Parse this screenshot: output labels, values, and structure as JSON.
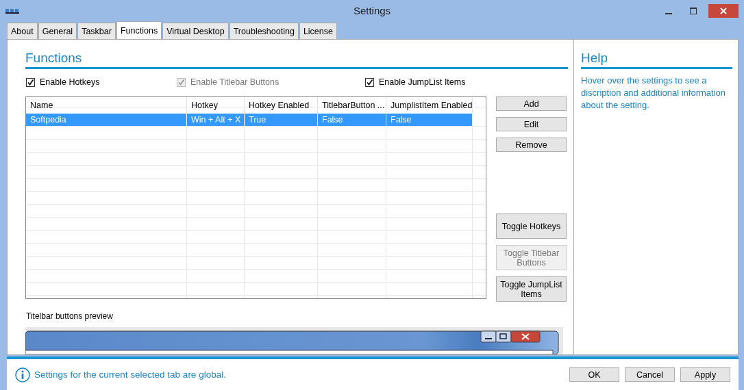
{
  "window": {
    "title": "Settings"
  },
  "tabs": [
    {
      "label": "About",
      "selected": false
    },
    {
      "label": "General",
      "selected": false
    },
    {
      "label": "Taskbar",
      "selected": false
    },
    {
      "label": "Functions",
      "selected": true
    },
    {
      "label": "Virtual Desktop",
      "selected": false
    },
    {
      "label": "Troubleshooting",
      "selected": false
    },
    {
      "label": "License",
      "selected": false
    }
  ],
  "section": {
    "title": "Functions"
  },
  "checkboxes": [
    {
      "label": "Enable Hotkeys",
      "checked": true,
      "disabled": false
    },
    {
      "label": "Enable Titlebar Buttons",
      "checked": true,
      "disabled": true
    },
    {
      "label": "Enable JumpList Items",
      "checked": true,
      "disabled": false
    }
  ],
  "table": {
    "columns": [
      "Name",
      "Hotkey",
      "Hotkey Enabled",
      "TitlebarButton ...",
      "JumplistItem Enabled"
    ],
    "rows": [
      {
        "cells": [
          "Softpedia",
          "Win + Alt + X",
          "True",
          "False",
          "False"
        ],
        "selected": true
      }
    ]
  },
  "row_buttons": [
    {
      "label": "Add",
      "disabled": false
    },
    {
      "label": "Edit",
      "disabled": false
    },
    {
      "label": "Remove",
      "disabled": false
    }
  ],
  "toggle_buttons": [
    {
      "label": "Toggle Hotkeys",
      "disabled": false
    },
    {
      "label": "Toggle Titlebar Buttons",
      "disabled": true
    },
    {
      "label": "Toggle JumpList Items",
      "disabled": false
    }
  ],
  "preview": {
    "label": "Titelbar buttons preview"
  },
  "help": {
    "title": "Help",
    "text": "Hover over the settings to see a discription and additional information about the setting."
  },
  "status": {
    "text": "Settings for the current selected tab are global."
  },
  "dialog_buttons": [
    "OK",
    "Cancel",
    "Apply"
  ]
}
